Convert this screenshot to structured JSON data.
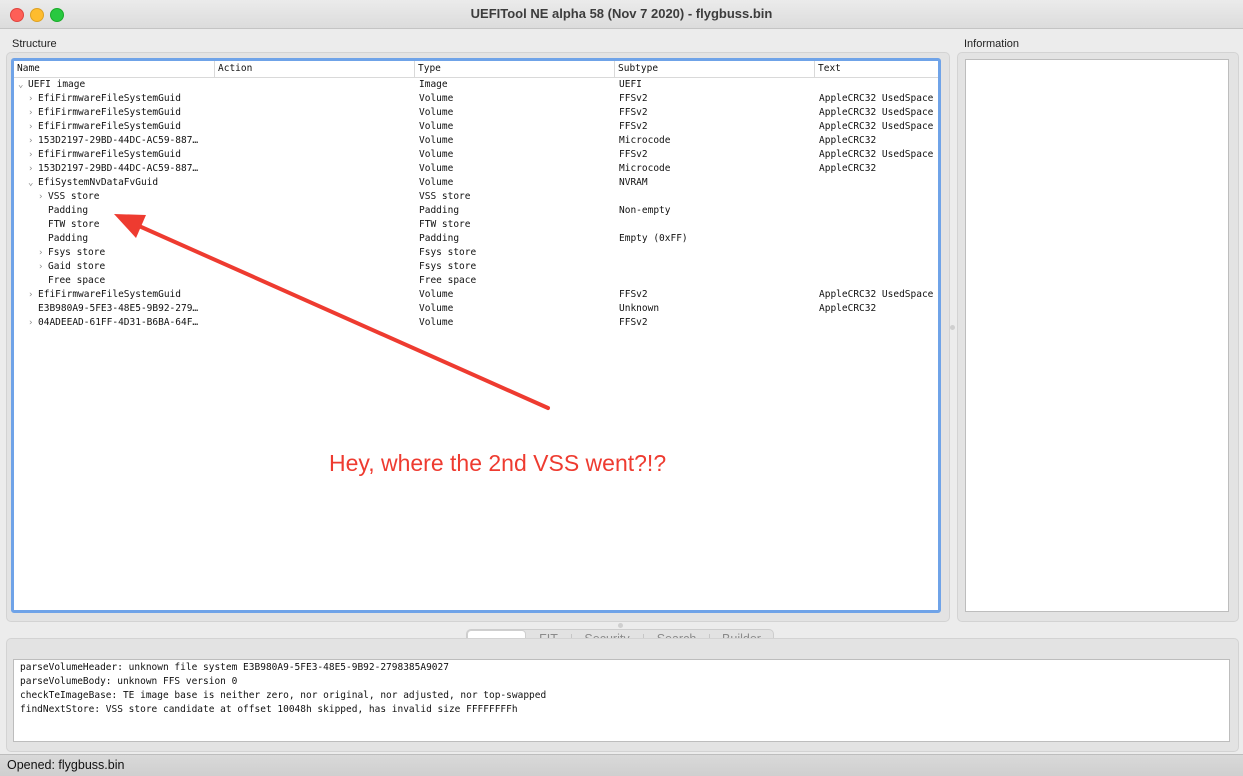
{
  "window": {
    "title": "UEFITool NE alpha 58 (Nov  7 2020) - flygbuss.bin"
  },
  "structure": {
    "label": "Structure",
    "columns": [
      "Name",
      "Action",
      "Type",
      "Subtype",
      "Text"
    ],
    "rows": [
      {
        "depth": 0,
        "expander": "open",
        "name": "UEFI image",
        "action": "",
        "type": "Image",
        "subtype": "UEFI",
        "text": ""
      },
      {
        "depth": 1,
        "expander": "closed",
        "name": "EfiFirmwareFileSystemGuid",
        "action": "",
        "type": "Volume",
        "subtype": "FFSv2",
        "text": "AppleCRC32 UsedSpace"
      },
      {
        "depth": 1,
        "expander": "closed",
        "name": "EfiFirmwareFileSystemGuid",
        "action": "",
        "type": "Volume",
        "subtype": "FFSv2",
        "text": "AppleCRC32 UsedSpace"
      },
      {
        "depth": 1,
        "expander": "closed",
        "name": "EfiFirmwareFileSystemGuid",
        "action": "",
        "type": "Volume",
        "subtype": "FFSv2",
        "text": "AppleCRC32 UsedSpace"
      },
      {
        "depth": 1,
        "expander": "closed",
        "name": "153D2197-29BD-44DC-AC59-887…",
        "action": "",
        "type": "Volume",
        "subtype": "Microcode",
        "text": "AppleCRC32"
      },
      {
        "depth": 1,
        "expander": "closed",
        "name": "EfiFirmwareFileSystemGuid",
        "action": "",
        "type": "Volume",
        "subtype": "FFSv2",
        "text": "AppleCRC32 UsedSpace"
      },
      {
        "depth": 1,
        "expander": "closed",
        "name": "153D2197-29BD-44DC-AC59-887…",
        "action": "",
        "type": "Volume",
        "subtype": "Microcode",
        "text": "AppleCRC32"
      },
      {
        "depth": 1,
        "expander": "open",
        "name": "EfiSystemNvDataFvGuid",
        "action": "",
        "type": "Volume",
        "subtype": "NVRAM",
        "text": ""
      },
      {
        "depth": 2,
        "expander": "closed",
        "name": "VSS store",
        "action": "",
        "type": "VSS store",
        "subtype": "",
        "text": ""
      },
      {
        "depth": 2,
        "expander": "none",
        "name": "Padding",
        "action": "",
        "type": "Padding",
        "subtype": "Non-empty",
        "text": ""
      },
      {
        "depth": 2,
        "expander": "none",
        "name": "FTW store",
        "action": "",
        "type": "FTW store",
        "subtype": "",
        "text": ""
      },
      {
        "depth": 2,
        "expander": "none",
        "name": "Padding",
        "action": "",
        "type": "Padding",
        "subtype": "Empty (0xFF)",
        "text": ""
      },
      {
        "depth": 2,
        "expander": "closed",
        "name": "Fsys store",
        "action": "",
        "type": "Fsys store",
        "subtype": "",
        "text": ""
      },
      {
        "depth": 2,
        "expander": "closed",
        "name": "Gaid store",
        "action": "",
        "type": "Fsys store",
        "subtype": "",
        "text": ""
      },
      {
        "depth": 2,
        "expander": "none",
        "name": "Free space",
        "action": "",
        "type": "Free space",
        "subtype": "",
        "text": ""
      },
      {
        "depth": 1,
        "expander": "closed",
        "name": "EfiFirmwareFileSystemGuid",
        "action": "",
        "type": "Volume",
        "subtype": "FFSv2",
        "text": "AppleCRC32 UsedSpace"
      },
      {
        "depth": 1,
        "expander": "none",
        "name": "E3B980A9-5FE3-48E5-9B92-279…",
        "action": "",
        "type": "Volume",
        "subtype": "Unknown",
        "text": "AppleCRC32"
      },
      {
        "depth": 1,
        "expander": "closed",
        "name": "04ADEEAD-61FF-4D31-B6BA-64F…",
        "action": "",
        "type": "Volume",
        "subtype": "FFSv2",
        "text": ""
      }
    ]
  },
  "information": {
    "label": "Information"
  },
  "tabs": [
    {
      "label": "",
      "selected": true
    },
    {
      "label": "FIT",
      "selected": false
    },
    {
      "label": "Security",
      "selected": false
    },
    {
      "label": "Search",
      "selected": false
    },
    {
      "label": "Builder",
      "selected": false
    }
  ],
  "messages": [
    "parseVolumeHeader: unknown file system E3B980A9-5FE3-48E5-9B92-2798385A9027",
    "parseVolumeBody: unknown FFS version 0",
    "checkTeImageBase: TE image base is neither zero, nor original, nor adjusted, nor top-swapped",
    "findNextStore: VSS store candidate at offset 10048h skipped, has invalid size FFFFFFFFh"
  ],
  "status": {
    "text": "Opened: flygbuss.bin"
  },
  "annotation": {
    "text": "Hey, where the 2nd VSS went?!?",
    "color": "#ee3b30"
  },
  "colors": {
    "selection_border": "#6fa3e8",
    "window_bg": "#ececec"
  }
}
